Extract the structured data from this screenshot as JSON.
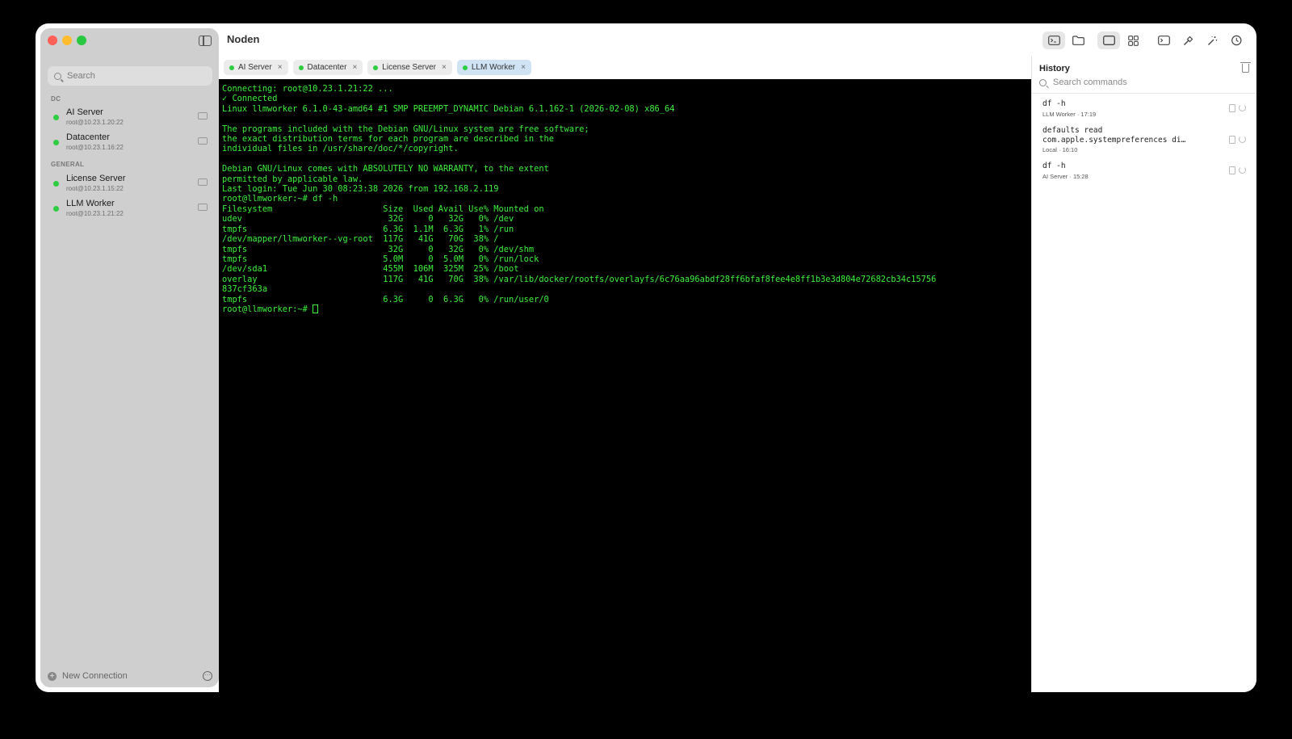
{
  "window": {
    "title": "Noden"
  },
  "colors": {
    "online": "#2ecc40",
    "terminal_fg": "#3df23d",
    "active_tab": "#cfe3f5"
  },
  "sidebar": {
    "search_placeholder": "Search",
    "groups": [
      {
        "title": "DC",
        "items": [
          {
            "name": "AI Server",
            "address": "root@10.23.1.20:22"
          },
          {
            "name": "Datacenter",
            "address": "root@10.23.1.16:22"
          }
        ]
      },
      {
        "title": "GENERAL",
        "items": [
          {
            "name": "License Server",
            "address": "root@10.23.1.15:22"
          },
          {
            "name": "LLM Worker",
            "address": "root@10.23.1.21:22"
          }
        ]
      }
    ],
    "new_connection_label": "New Connection"
  },
  "toolbar": {
    "icons": [
      "terminal-icon",
      "folder-icon",
      "single-pane-icon",
      "grid-icon",
      "console-icon",
      "hammer-icon",
      "magic-wand-icon",
      "history-icon"
    ]
  },
  "tabs": [
    {
      "label": "AI Server",
      "close": "×"
    },
    {
      "label": "Datacenter",
      "close": "×"
    },
    {
      "label": "License Server",
      "close": "×"
    },
    {
      "label": "LLM Worker",
      "close": "×"
    }
  ],
  "terminal": {
    "output": "Connecting: root@10.23.1.21:22 ...\n✓ Connected\nLinux llmworker 6.1.0-43-amd64 #1 SMP PREEMPT_DYNAMIC Debian 6.1.162-1 (2026-02-08) x86_64\n\nThe programs included with the Debian GNU/Linux system are free software;\nthe exact distribution terms for each program are described in the\nindividual files in /usr/share/doc/*/copyright.\n\nDebian GNU/Linux comes with ABSOLUTELY NO WARRANTY, to the extent\npermitted by applicable law.\nLast login: Tue Jun 30 08:23:38 2026 from 192.168.2.119\nroot@llmworker:~# df -h\nFilesystem                      Size  Used Avail Use% Mounted on\nudev                             32G     0   32G   0% /dev\ntmpfs                           6.3G  1.1M  6.3G   1% /run\n/dev/mapper/llmworker--vg-root  117G   41G   70G  38% /\ntmpfs                            32G     0   32G   0% /dev/shm\ntmpfs                           5.0M     0  5.0M   0% /run/lock\n/dev/sda1                       455M  106M  325M  25% /boot\noverlay                         117G   41G   70G  38% /var/lib/docker/rootfs/overlayfs/6c76aa96abdf28ff6bfaf8fee4e8ff1b3e3d804e72682cb34c15756\n837cf363a\ntmpfs                           6.3G     0  6.3G   0% /run/user/0",
    "prompt": "root@llmworker:~# "
  },
  "history": {
    "title": "History",
    "search_placeholder": "Search commands",
    "items": [
      {
        "command": "df -h",
        "source": "LLM Worker",
        "time": "17:19"
      },
      {
        "command": "defaults read",
        "command_line2": "com.apple.systempreferences di…",
        "source": "Local",
        "time": "16:10"
      },
      {
        "command": "df -h",
        "source": "AI Server",
        "time": "15:28"
      }
    ],
    "separator": "·"
  }
}
